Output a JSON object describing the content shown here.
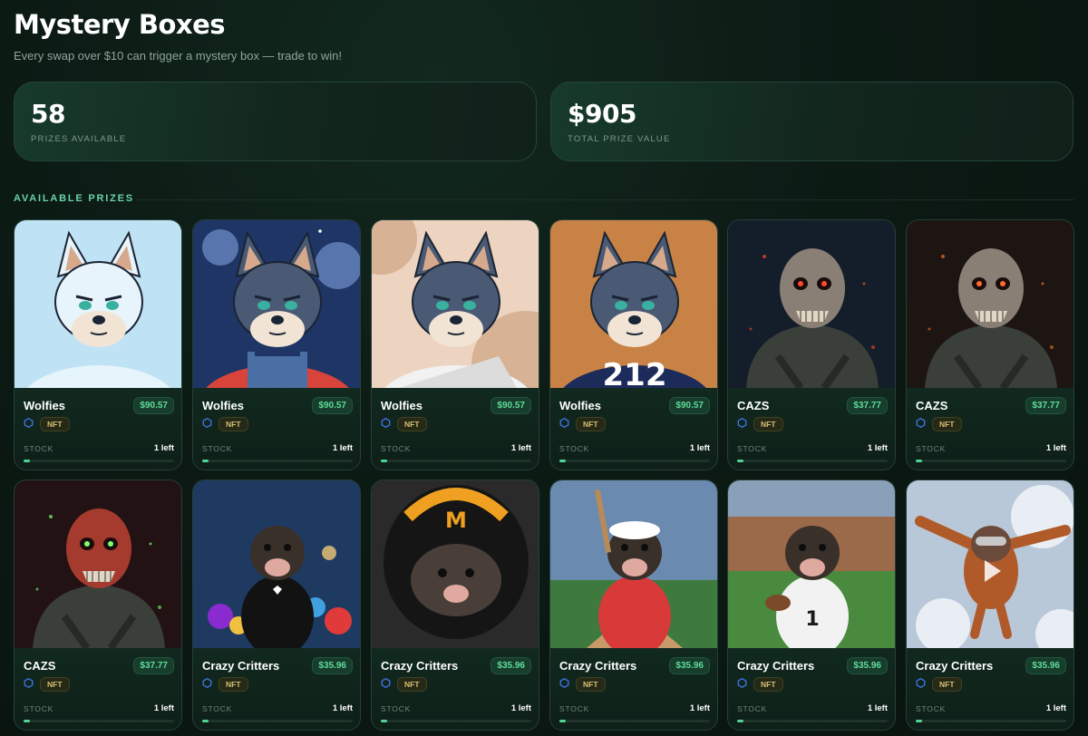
{
  "header": {
    "title": "Mystery Boxes",
    "subtitle": "Every swap over $10 can trigger a mystery box — trade to win!"
  },
  "stats": [
    {
      "value": "58",
      "label": "PRIZES AVAILABLE"
    },
    {
      "value": "$905",
      "label": "TOTAL PRIZE VALUE"
    }
  ],
  "section": {
    "title": "AVAILABLE PRIZES"
  },
  "colors": {
    "accent": "#52d396",
    "price_text": "#5fdc9a",
    "nft_badge_text": "#d6bf74",
    "chain_icon": "#3b6fd8"
  },
  "prizes": [
    {
      "name": "Wolfies",
      "price": "$90.57",
      "type": "NFT",
      "stock_label": "STOCK",
      "stock_text": "1 left",
      "stock_fraction": 0.04,
      "icon": "chain-hexagon-icon",
      "art": "wolf-sketch"
    },
    {
      "name": "Wolfies",
      "price": "$90.57",
      "type": "NFT",
      "stock_label": "STOCK",
      "stock_text": "1 left",
      "stock_fraction": 0.04,
      "icon": "chain-hexagon-icon",
      "art": "wolf-red-overalls"
    },
    {
      "name": "Wolfies",
      "price": "$90.57",
      "type": "NFT",
      "stock_label": "STOCK",
      "stock_text": "1 left",
      "stock_fraction": 0.04,
      "icon": "chain-hexagon-icon",
      "art": "wolf-toga"
    },
    {
      "name": "Wolfies",
      "price": "$90.57",
      "type": "NFT",
      "stock_label": "STOCK",
      "stock_text": "1 left",
      "stock_fraction": 0.04,
      "icon": "chain-hexagon-icon",
      "art": "wolf-jersey-212"
    },
    {
      "name": "CAZS",
      "price": "$37.77",
      "type": "NFT",
      "stock_label": "STOCK",
      "stock_text": "1 left",
      "stock_fraction": 0.04,
      "icon": "chain-hexagon-icon",
      "art": "zombie-soldier-blue"
    },
    {
      "name": "CAZS",
      "price": "$37.77",
      "type": "NFT",
      "stock_label": "STOCK",
      "stock_text": "1 left",
      "stock_fraction": 0.04,
      "icon": "chain-hexagon-icon",
      "art": "zombie-soldier-red"
    },
    {
      "name": "CAZS",
      "price": "$37.77",
      "type": "NFT",
      "stock_label": "STOCK",
      "stock_text": "1 left",
      "stock_fraction": 0.04,
      "icon": "chain-hexagon-icon",
      "art": "zombie-soldier-armor"
    },
    {
      "name": "Crazy Critters",
      "price": "$35.96",
      "type": "NFT",
      "stock_label": "STOCK",
      "stock_text": "1 left",
      "stock_fraction": 0.04,
      "icon": "chain-hexagon-icon",
      "art": "mole-tuxedo"
    },
    {
      "name": "Crazy Critters",
      "price": "$35.96",
      "type": "NFT",
      "stock_label": "STOCK",
      "stock_text": "1 left",
      "stock_fraction": 0.04,
      "icon": "chain-hexagon-icon",
      "art": "mole-racer-helmet"
    },
    {
      "name": "Crazy Critters",
      "price": "$35.96",
      "type": "NFT",
      "stock_label": "STOCK",
      "stock_text": "1 left",
      "stock_fraction": 0.04,
      "icon": "chain-hexagon-icon",
      "art": "mole-baseball"
    },
    {
      "name": "Crazy Critters",
      "price": "$35.96",
      "type": "NFT",
      "stock_label": "STOCK",
      "stock_text": "1 left",
      "stock_fraction": 0.04,
      "icon": "chain-hexagon-icon",
      "art": "mole-football"
    },
    {
      "name": "Crazy Critters",
      "price": "$35.96",
      "type": "NFT",
      "stock_label": "STOCK",
      "stock_text": "1 left",
      "stock_fraction": 0.04,
      "icon": "chain-hexagon-icon",
      "art": "mole-skydiver"
    }
  ]
}
